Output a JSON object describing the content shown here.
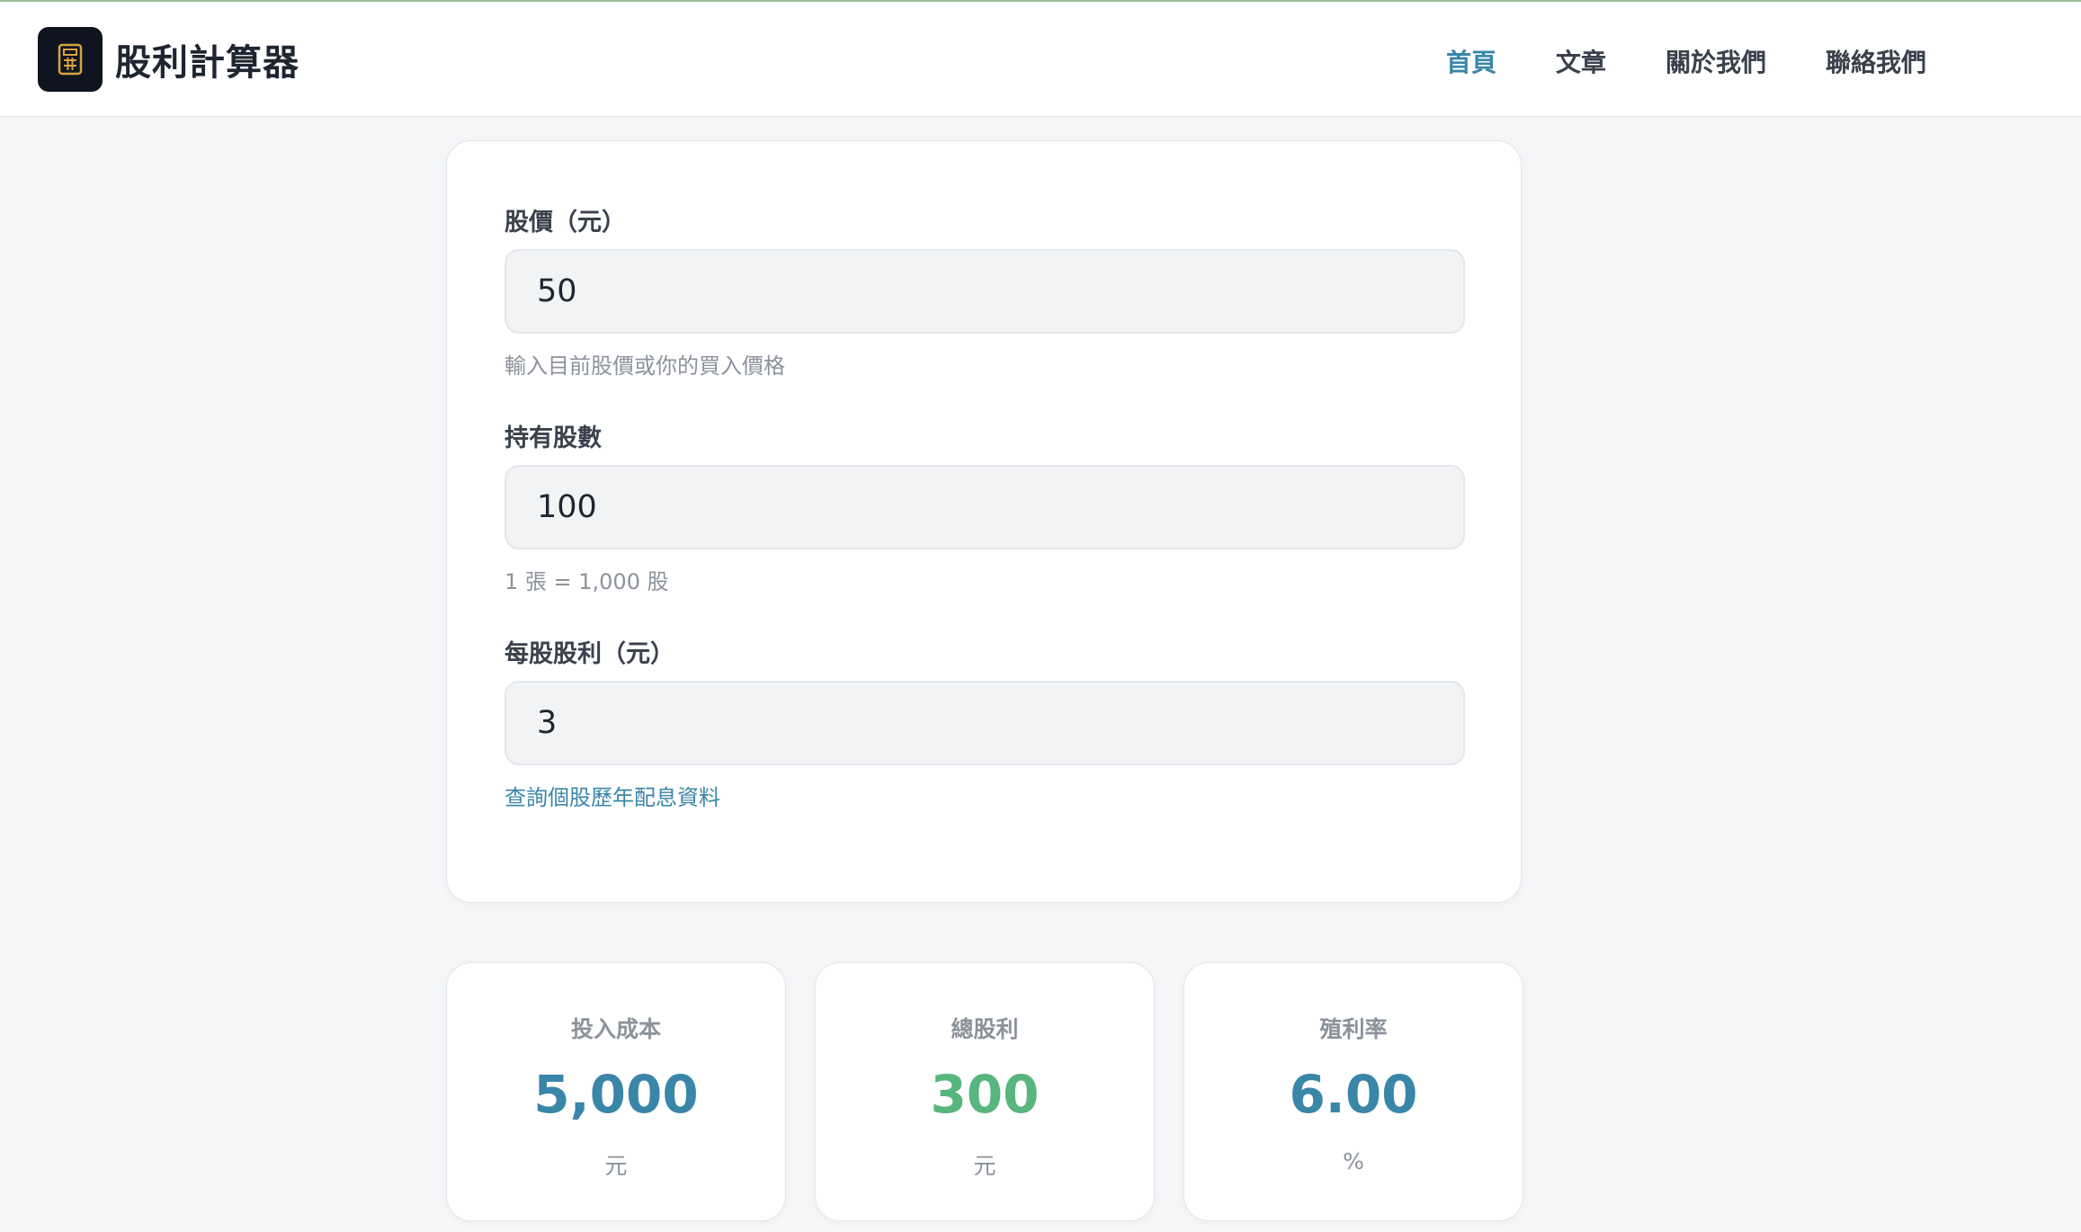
{
  "header": {
    "title": "股利計算器",
    "nav": [
      "首頁",
      "文章",
      "關於我們",
      "聯絡我們"
    ]
  },
  "form": {
    "price": {
      "label": "股價（元）",
      "value": "50",
      "hint": "輸入目前股價或你的買入價格"
    },
    "shares": {
      "label": "持有股數",
      "value": "100",
      "hint": "1 張 = 1,000 股"
    },
    "dividend": {
      "label": "每股股利（元）",
      "value": "3",
      "link": "查詢個股歷年配息資料"
    }
  },
  "results": [
    {
      "label": "投入成本",
      "value": "5,000",
      "unit": "元"
    },
    {
      "label": "總股利",
      "value": "300",
      "unit": "元"
    },
    {
      "label": "殖利率",
      "value": "6.00",
      "unit": "%"
    }
  ],
  "colors": {
    "accent": "#3a86a8",
    "positive": "#58b57d"
  }
}
